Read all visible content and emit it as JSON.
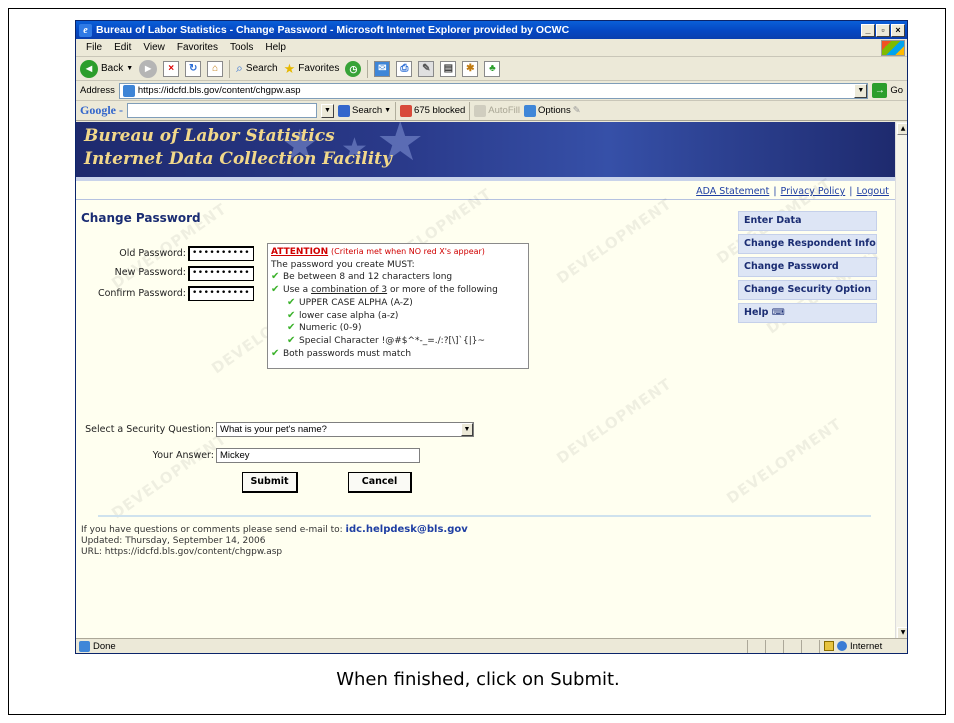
{
  "browser": {
    "title": "Bureau of Labor Statistics - Change Password - Microsoft Internet Explorer provided by OCWC",
    "menu": [
      "File",
      "Edit",
      "View",
      "Favorites",
      "Tools",
      "Help"
    ],
    "toolbar": {
      "back": "Back",
      "search": "Search",
      "favorites": "Favorites"
    },
    "address_label": "Address",
    "address_value": "https://idcfd.bls.gov/content/chgpw.asp",
    "go_label": "Go",
    "google": {
      "logo": "Google -",
      "search": "Search",
      "blocked": "675 blocked",
      "autofill": "AutoFill",
      "options": "Options"
    },
    "status": {
      "left": "Done",
      "zone": "Internet"
    }
  },
  "banner": {
    "line1": "Bureau of Labor Statistics",
    "line2": "Internet Data Collection Facility"
  },
  "top_links": [
    "ADA Statement",
    "Privacy Policy",
    "Logout"
  ],
  "page": {
    "title": "Change Password",
    "old_password_label": "Old Password:",
    "old_password_value": "••••••••••",
    "new_password_label": "New Password:",
    "new_password_value": "••••••••••",
    "confirm_password_label": "Confirm Password:",
    "confirm_password_value": "••••••••••"
  },
  "attention": {
    "title": "ATTENTION",
    "note": "(Criteria met when NO red X's appear)",
    "intro": "The password you create MUST:",
    "rule1": "Be between 8 and 12 characters long",
    "rule2_pre": "Use a ",
    "rule2_link": "combination of 3",
    "rule2_post": " or more of the following",
    "sub1": "UPPER CASE ALPHA (A-Z)",
    "sub2": "lower case alpha (a-z)",
    "sub3": "Numeric (0-9)",
    "sub4": "Special Character !@#$^*-_=./:?[\\]`{|}~",
    "rule3": "Both passwords must match"
  },
  "security": {
    "question_label": "Select a Security Question:",
    "question_value": "What is your pet's name?",
    "answer_label": "Your Answer:",
    "answer_value": "Mickey",
    "submit": "Submit",
    "cancel": "Cancel"
  },
  "sidebar": [
    "Enter Data",
    "Change Respondent Info",
    "Change Password",
    "Change Security Option",
    "Help"
  ],
  "footer": {
    "contact_pre": "If you have questions or comments please send e-mail to: ",
    "contact_email": "idc.helpdesk@bls.gov",
    "updated": "Updated: Thursday, September 14, 2006",
    "url": "URL: https://idcfd.bls.gov/content/chgpw.asp"
  },
  "watermark": "DEVELOPMENT",
  "caption": "When finished, click on Submit."
}
